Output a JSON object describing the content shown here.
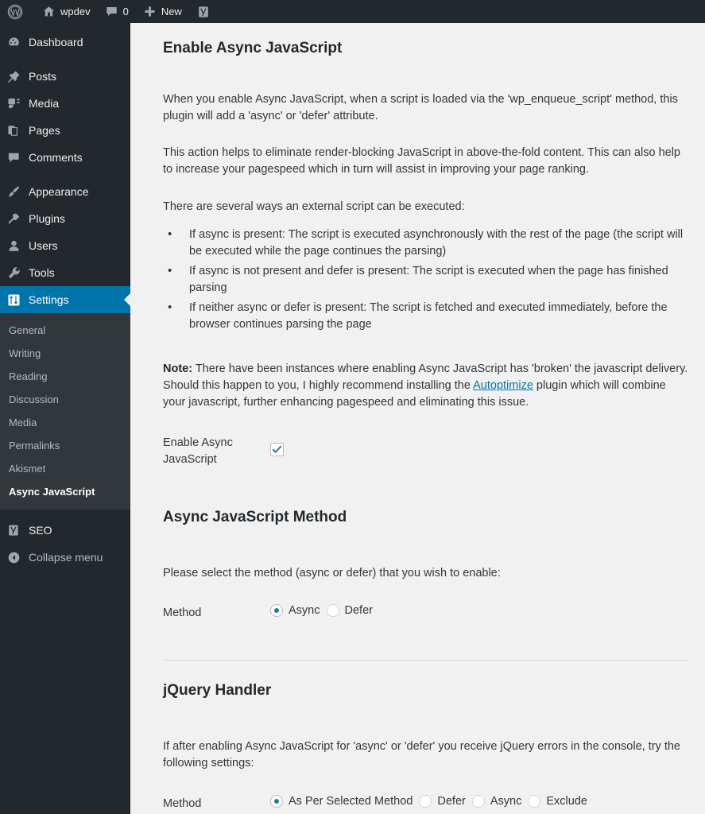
{
  "adminbar": {
    "items": [
      {
        "icon": "wordpress-logo-icon",
        "label": ""
      },
      {
        "icon": "home-icon",
        "label": "wpdev"
      },
      {
        "icon": "comment-bubble-icon",
        "label": "0"
      },
      {
        "icon": "plus-icon",
        "label": "New"
      },
      {
        "icon": "yoast-seo-icon",
        "label": ""
      }
    ]
  },
  "sidebar": {
    "top_items": [
      {
        "label": "Dashboard",
        "icon": "dashboard-icon",
        "current": false
      },
      {
        "label": "Posts",
        "icon": "pin-icon",
        "current": false
      },
      {
        "label": "Media",
        "icon": "media-icon",
        "current": false
      },
      {
        "label": "Pages",
        "icon": "pages-icon",
        "current": false
      },
      {
        "label": "Comments",
        "icon": "comment-bubble-icon",
        "current": false
      },
      {
        "label": "Appearance",
        "icon": "paintbrush-icon",
        "current": false
      },
      {
        "label": "Plugins",
        "icon": "plug-icon",
        "current": false
      },
      {
        "label": "Users",
        "icon": "user-icon",
        "current": false
      },
      {
        "label": "Tools",
        "icon": "wrench-icon",
        "current": false
      },
      {
        "label": "Settings",
        "icon": "settings-sliders-icon",
        "current": true
      }
    ],
    "submenu": [
      {
        "label": "General",
        "current": false
      },
      {
        "label": "Writing",
        "current": false
      },
      {
        "label": "Reading",
        "current": false
      },
      {
        "label": "Discussion",
        "current": false
      },
      {
        "label": "Media",
        "current": false
      },
      {
        "label": "Permalinks",
        "current": false
      },
      {
        "label": "Akismet",
        "current": false
      },
      {
        "label": "Async JavaScript",
        "current": true
      }
    ],
    "footer_items": [
      {
        "label": "SEO",
        "icon": "yoast-seo-icon"
      },
      {
        "label": "Collapse menu",
        "icon": "collapse-arrow-icon"
      }
    ]
  },
  "main": {
    "enable_section": {
      "title": "Enable Async JavaScript",
      "paragraph1": "When you enable Async JavaScript, when a script is loaded via the 'wp_enqueue_script' method, this plugin will add a 'async' or 'defer' attribute.",
      "paragraph2": "This action helps to eliminate render-blocking JavaScript in above-the-fold content. This can also help to increase your pagespeed which in turn will assist in improving your page ranking.",
      "paragraph3": "There are several ways an external script can be executed:",
      "bullets": [
        "If async is present: The script is executed asynchronously with the rest of the page (the script will be executed while the page continues the parsing)",
        "If async is not present and defer is present: The script is executed when the page has finished parsing",
        "If neither async or defer is present: The script is fetched and executed immediately, before the browser continues parsing the page"
      ],
      "note_label": "Note:",
      "note_part1": " There have been instances where enabling Async JavaScript has 'broken' the javascript delivery. Should this happen to you, I highly recommend installing the ",
      "note_link": "Autoptimize",
      "note_part2": " plugin which will combine your javascript, further enhancing pagespeed and eliminating this issue.",
      "field_label": "Enable Async JavaScript",
      "checkbox_checked": true
    },
    "method_section": {
      "title": "Async JavaScript Method",
      "description": "Please select the method (async or defer) that you wish to enable:",
      "field_label": "Method",
      "options": [
        {
          "label": "Async",
          "checked": true
        },
        {
          "label": "Defer",
          "checked": false
        }
      ]
    },
    "jquery_section": {
      "title": "jQuery Handler",
      "description": "If after enabling Async JavaScript for 'async' or 'defer' you receive jQuery errors in the console, try the following settings:",
      "field_label": "Method",
      "options": [
        {
          "label": "As Per Selected Method",
          "checked": true
        },
        {
          "label": "Defer",
          "checked": false
        },
        {
          "label": "Async",
          "checked": false
        },
        {
          "label": "Exclude",
          "checked": false
        }
      ]
    }
  },
  "colors": {
    "admin_bar": "#23282d",
    "sidebar": "#23282d",
    "submenu": "#32373c",
    "accent": "#0073aa",
    "content_bg": "#f1f1f1",
    "radio_dot": "#1a7f94",
    "checkmark": "#3a6e8f"
  }
}
